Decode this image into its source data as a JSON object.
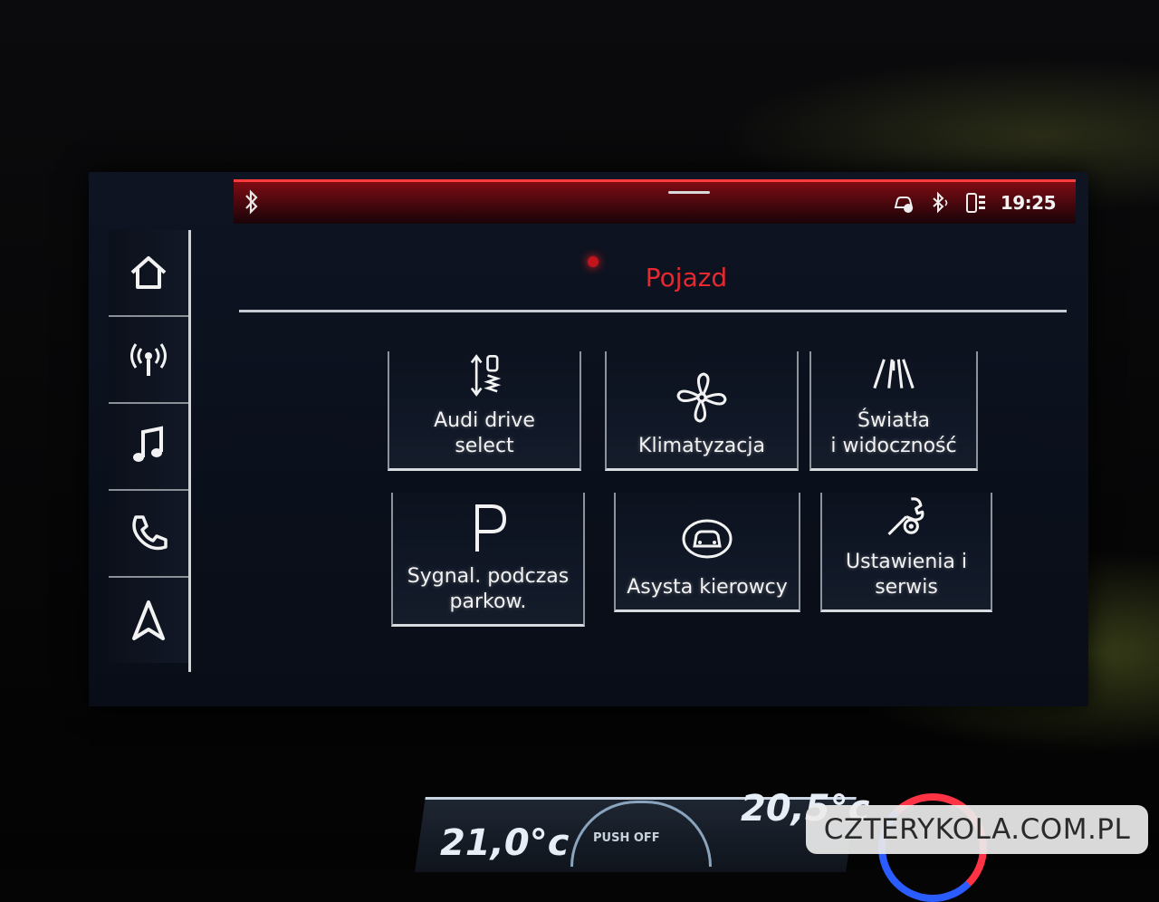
{
  "status_bar": {
    "clock": "19:25",
    "icons": [
      "bluetooth-icon",
      "car-signal-icon",
      "bluetooth-icon",
      "phone-battery-icon"
    ]
  },
  "sidebar": {
    "items": [
      {
        "icon": "home-icon"
      },
      {
        "icon": "radio-antenna-icon"
      },
      {
        "icon": "music-note-icon"
      },
      {
        "icon": "phone-icon"
      },
      {
        "icon": "navigation-arrow-icon"
      }
    ]
  },
  "page": {
    "title": "Pojazd"
  },
  "tiles": [
    {
      "label_lines": [
        "Audi drive",
        "select"
      ],
      "icon": "suspension-icon"
    },
    {
      "label_lines": [
        "Klimatyzacja"
      ],
      "icon": "fan-icon"
    },
    {
      "label_lines": [
        "Światła",
        "i widoczność"
      ],
      "icon": "headlight-road-icon"
    },
    {
      "label_lines": [
        "Sygnal. podczas",
        "parkow."
      ],
      "icon": "parking-icon"
    },
    {
      "label_lines": [
        "Asysta kierowcy"
      ],
      "icon": "driver-assist-icon"
    },
    {
      "label_lines": [
        "Ustawienia i",
        "serwis"
      ],
      "icon": "wrench-gear-icon"
    }
  ],
  "climate_cluster": {
    "left_temp": "21,0°c",
    "right_temp": "20,5°c",
    "push_off": "PUSH OFF"
  },
  "watermark": "CZTERYKOLA.COM.PL",
  "colors": {
    "accent": "#e8282e",
    "background": "#0b111d",
    "tile_border": "#d7dade"
  }
}
